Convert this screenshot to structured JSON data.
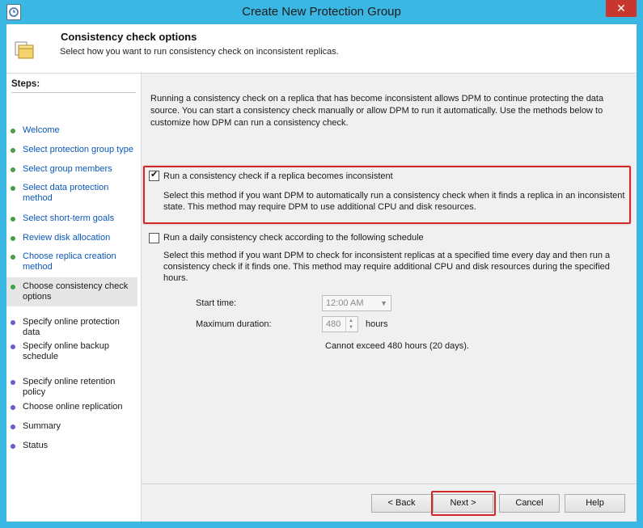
{
  "window": {
    "title": "Create New Protection Group",
    "close_glyph": "✕"
  },
  "header": {
    "title": "Consistency check options",
    "subtitle": "Select how you want to run consistency check on inconsistent replicas."
  },
  "steps": {
    "title": "Steps:",
    "items": [
      {
        "label": "Welcome",
        "state": "done"
      },
      {
        "label": "Select protection group type",
        "state": "done"
      },
      {
        "label": "Select group members",
        "state": "done"
      },
      {
        "label": "Select data protection method",
        "state": "done"
      },
      {
        "label": "Select short-term goals",
        "state": "done"
      },
      {
        "label": "Review disk allocation",
        "state": "done"
      },
      {
        "label": "Choose replica creation method",
        "state": "done"
      },
      {
        "label": "Choose consistency check options",
        "state": "current"
      },
      {
        "label": "Specify online protection data",
        "state": "todo"
      },
      {
        "label": "Specify online backup schedule",
        "state": "todo"
      },
      {
        "label": "Specify online retention policy",
        "state": "todo"
      },
      {
        "label": "Choose online replication",
        "state": "todo"
      },
      {
        "label": "Summary",
        "state": "todo"
      },
      {
        "label": "Status",
        "state": "todo"
      }
    ]
  },
  "content": {
    "intro": "Running a consistency check on a replica that has become inconsistent allows DPM to continue protecting the data source. You can start a consistency check manually or allow DPM to run it automatically. Use the methods below to customize how DPM can run a consistency check.",
    "option1": {
      "label": "Run a consistency check if a replica becomes inconsistent",
      "checked": true,
      "description": "Select this method if you want DPM to automatically run a consistency check when it finds a replica in an inconsistent state. This method may require DPM to use additional CPU and disk resources."
    },
    "option2": {
      "label": "Run a daily consistency check according to the following schedule",
      "checked": false,
      "description": "Select this method if you want DPM to check for inconsistent replicas at a specified time every day and then run a consistency check if it finds one. This method may require additional CPU and disk resources during the specified hours."
    },
    "schedule": {
      "start_time_label": "Start time:",
      "start_time_value": "12:00 AM",
      "max_duration_label": "Maximum duration:",
      "max_duration_value": "480",
      "hours_label": "hours",
      "limit_note": "Cannot exceed 480 hours (20 days)."
    }
  },
  "buttons": {
    "back": "< Back",
    "next": "Next >",
    "cancel": "Cancel",
    "help": "Help"
  },
  "colors": {
    "highlight": "#d0282b",
    "link": "#0b57b8",
    "done_dot": "#43a047",
    "todo_dot": "#6a5acd"
  }
}
